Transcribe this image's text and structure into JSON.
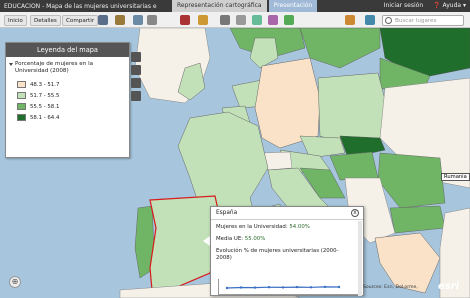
{
  "titlebar": {
    "title": "EDUCACIÓN - Mapa de las mujeres universitarias e",
    "tabs": [
      {
        "label": "Representación cartográfica",
        "active": false
      },
      {
        "label": "Presentación",
        "active": true
      }
    ],
    "signin": "Iniciar sesión",
    "help": "Ayuda"
  },
  "toolbar": {
    "buttons": [
      "Inicio",
      "Detalles",
      "Compartir"
    ],
    "search_placeholder": "Buscar lugares"
  },
  "legend": {
    "header": "Leyenda del mapa",
    "title": "Porcentaje de mujeres en la Universidad (2008)",
    "classes": [
      {
        "label": "48.3 - 51.7",
        "color": "#f9e2c7"
      },
      {
        "label": "51.7 - 55.5",
        "color": "#c2e1b8"
      },
      {
        "label": "55.5 - 58.1",
        "color": "#6fb565"
      },
      {
        "label": "58.1 - 64.4",
        "color": "#1f6e2c"
      }
    ]
  },
  "map_labels": {
    "romania": "Rumania",
    "attribution": "Sources: Esri, DeLorme,",
    "logo": "esri"
  },
  "popup": {
    "title": "España",
    "univ_label": "Mujeres en la Universidad:",
    "univ_value": "54.00%",
    "ue_label": "Media UE:",
    "ue_value": "55.00%",
    "evol_label": "Evolución % de mujeres universitarias (2000-2008)",
    "close": "x"
  },
  "colors": {
    "sea": "#a7c6de",
    "land_base": "#f5f1e8"
  }
}
